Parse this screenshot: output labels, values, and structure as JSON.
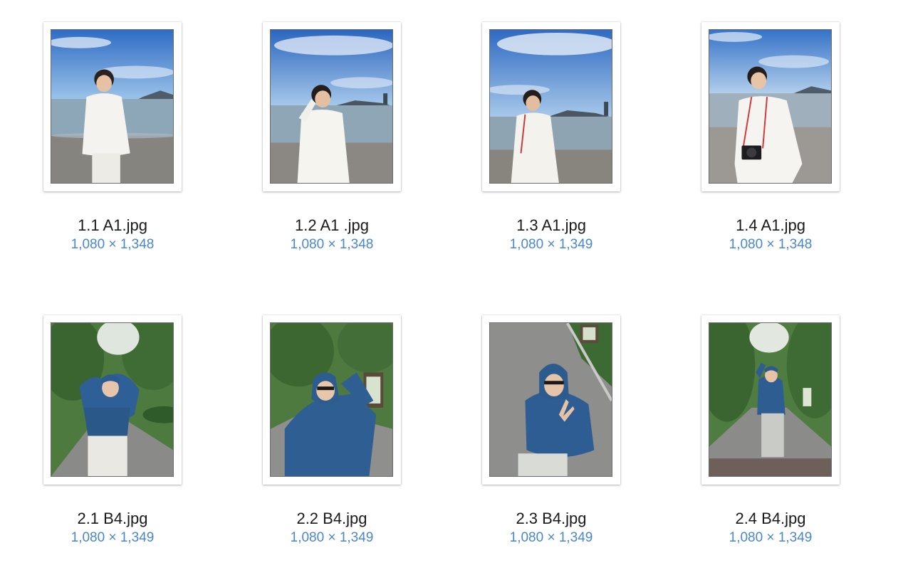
{
  "files": [
    {
      "name": "1.1 A1.jpg",
      "dimensions": "1,080 × 1,348",
      "scene": "beach-white-shirt"
    },
    {
      "name": "1.2 A1 .jpg",
      "dimensions": "1,080 × 1,348",
      "scene": "beach-white-shirt"
    },
    {
      "name": "1.3 A1.jpg",
      "dimensions": "1,080 × 1,349",
      "scene": "beach-white-shirt"
    },
    {
      "name": "1.4 A1.jpg",
      "dimensions": "1,080 × 1,348",
      "scene": "beach-white-shirt-camera"
    },
    {
      "name": "2.1 B4.jpg",
      "dimensions": "1,080 × 1,349",
      "scene": "forest-road-blue-hoodie"
    },
    {
      "name": "2.2 B4.jpg",
      "dimensions": "1,080 × 1,349",
      "scene": "forest-road-blue-hoodie"
    },
    {
      "name": "2.3 B4.jpg",
      "dimensions": "1,080 × 1,349",
      "scene": "road-blue-hoodie-closeup"
    },
    {
      "name": "2.4 B4.jpg",
      "dimensions": "1,080 × 1,349",
      "scene": "forest-road-blue-hoodie-far"
    }
  ],
  "colors": {
    "filename_text": "#1a1a1a",
    "dimensions_text": "#4a86cf",
    "sky": "#3f7ed2",
    "sea": "#8aa3b4",
    "sand": "#8c8a86",
    "forest": "#3f6b35",
    "road": "#8c8c8c",
    "hoodie": "#2f5f94"
  }
}
